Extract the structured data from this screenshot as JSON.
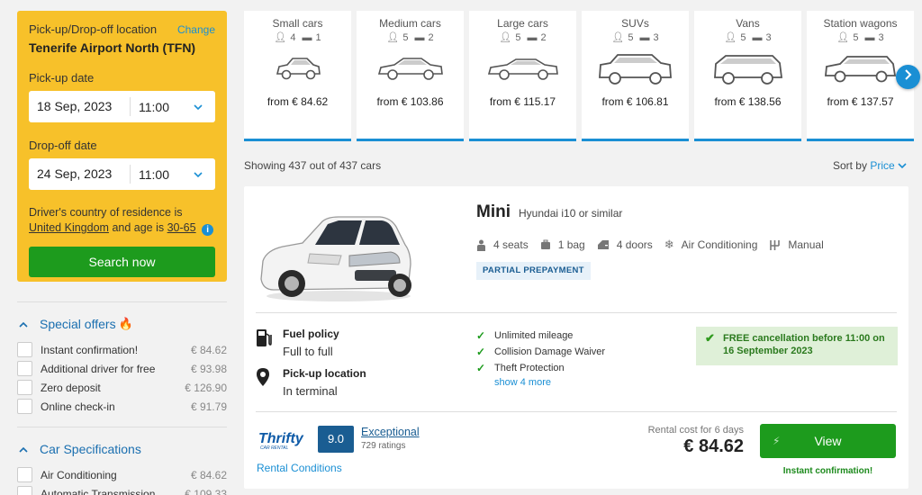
{
  "search": {
    "location_label": "Pick-up/Drop-off location",
    "change_label": "Change",
    "location": "Tenerife Airport North (TFN)",
    "pickup_label": "Pick-up date",
    "pickup_date": "18 Sep, 2023",
    "pickup_time": "11:00",
    "dropoff_label": "Drop-off date",
    "dropoff_date": "24 Sep, 2023",
    "dropoff_time": "11:00",
    "driver_text_1": "Driver's country of residence is",
    "country": "United Kingdom",
    "driver_text_2": "and age is",
    "age": "30-65",
    "search_button": "Search now"
  },
  "filters": {
    "special_offers": {
      "title": "Special offers",
      "items": [
        {
          "label": "Instant confirmation!",
          "price": "€ 84.62"
        },
        {
          "label": "Additional driver for free",
          "price": "€ 93.98"
        },
        {
          "label": "Zero deposit",
          "price": "€ 126.90"
        },
        {
          "label": "Online check-in",
          "price": "€ 91.79"
        }
      ]
    },
    "car_specs": {
      "title": "Car Specifications",
      "items": [
        {
          "label": "Air Conditioning",
          "price": "€ 84.62"
        },
        {
          "label": "Automatic Transmission",
          "price": "€ 109.33"
        }
      ]
    }
  },
  "categories": [
    {
      "name": "Small cars",
      "seats": "4",
      "bags": "1",
      "price": "from € 84.62"
    },
    {
      "name": "Medium cars",
      "seats": "5",
      "bags": "2",
      "price": "from € 103.86"
    },
    {
      "name": "Large cars",
      "seats": "5",
      "bags": "2",
      "price": "from € 115.17"
    },
    {
      "name": "SUVs",
      "seats": "5",
      "bags": "3",
      "price": "from € 106.81"
    },
    {
      "name": "Vans",
      "seats": "5",
      "bags": "3",
      "price": "from € 138.56"
    },
    {
      "name": "Station wagons",
      "seats": "5",
      "bags": "3",
      "price": "from € 137.57"
    }
  ],
  "results": {
    "showing": "Showing 437 out of 437 cars",
    "sort_label": "Sort by",
    "sort_value": "Price"
  },
  "car": {
    "class": "Mini",
    "model": "Hyundai i10 or similar",
    "seats": "4 seats",
    "bags": "1 bag",
    "doors": "4 doors",
    "ac": "Air Conditioning",
    "transmission": "Manual",
    "prepayment": "PARTIAL PREPAYMENT",
    "fuel_policy_label": "Fuel policy",
    "fuel_policy": "Full to full",
    "pickup_location_label": "Pick-up location",
    "pickup_location": "In terminal",
    "inclusions": [
      "Unlimited mileage",
      "Collision Damage Waiver",
      "Theft Protection"
    ],
    "show_more": "show 4 more",
    "cancellation": "FREE cancellation before 11:00 on 16 September 2023",
    "supplier_rating": "9.0",
    "rating_label": "Exceptional",
    "rating_count": "729 ratings",
    "rental_conditions": "Rental Conditions",
    "cost_label": "Rental cost for 6 days",
    "cost": "€ 84.62",
    "view_button": "View",
    "instant": "Instant confirmation!"
  },
  "colors": {
    "panel": "#f7c12a",
    "accent": "#1a8fd4",
    "green": "#1d9b1d",
    "navy": "#1a5d92"
  }
}
